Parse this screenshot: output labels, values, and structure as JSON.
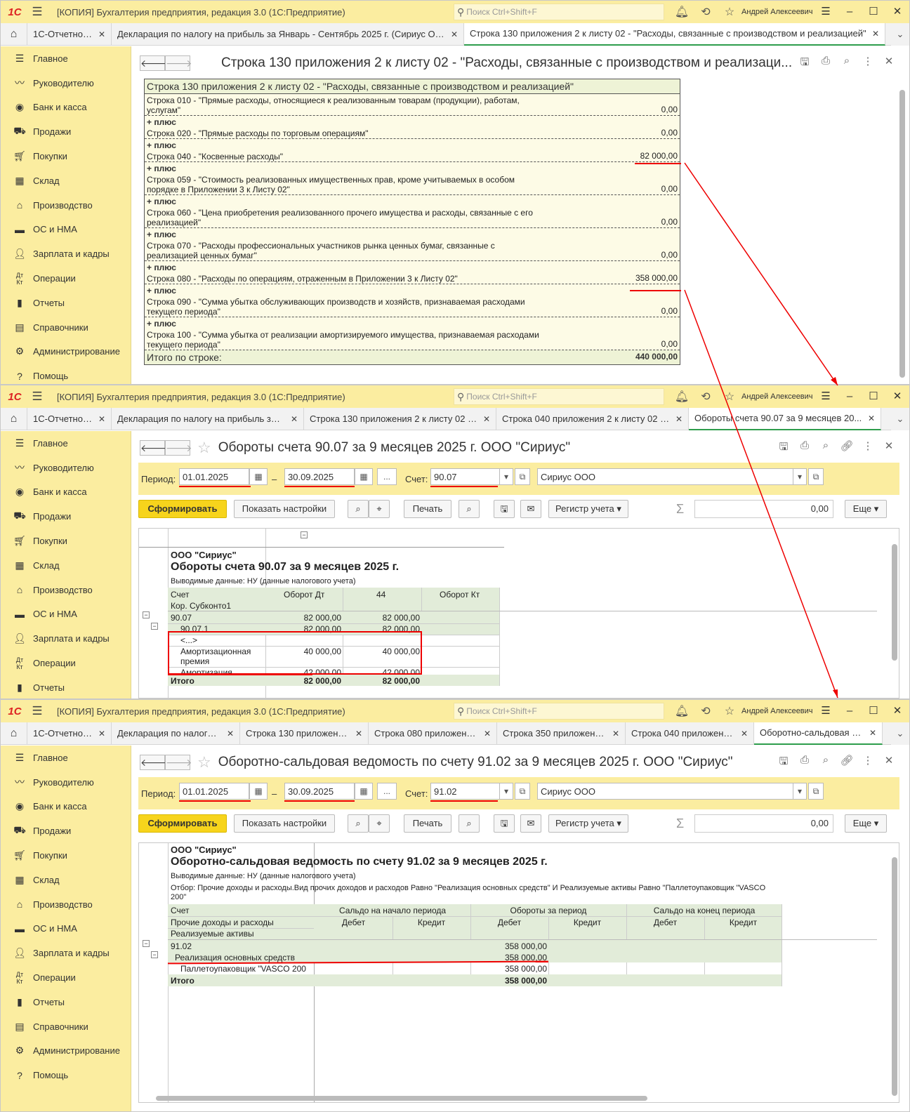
{
  "app": {
    "title": "[КОПИЯ] Бухгалтерия предприятия, редакция 3.0  (1С:Предприятие)",
    "search_placeholder": "Поиск Ctrl+Shift+F",
    "user": "Андрей Алексеевич",
    "logo": "1С"
  },
  "sidebar": [
    "Главное",
    "Руководителю",
    "Банк и касса",
    "Продажи",
    "Покупки",
    "Склад",
    "Производство",
    "ОС и НМА",
    "Зарплата и кадры",
    "Операции",
    "Отчеты",
    "Справочники",
    "Администрирование",
    "Помощь"
  ],
  "w1": {
    "tabs": [
      "1С-Отчетность",
      "Декларация по налогу на прибыль за Январь - Сентябрь 2025 г. (Сириус ООО)",
      "Строка 130 приложения 2 к листу 02 - \"Расходы, связанные с производством и реализацией\""
    ],
    "page_title": "Строка 130 приложения 2 к листу 02 - \"Расходы, связанные с производством и реализаци...",
    "table_title": "Строка 130 приложения 2 к листу 02 - \"Расходы, связанные с производством и реализацией\"",
    "plus": "+ плюс",
    "rows": [
      {
        "l1": "Строка 010 - \"Прямые расходы, относящиеся к реализованным товарам (продукции), работам,",
        "l2": "услугам\"",
        "v": "0,00"
      },
      {
        "l1": "Строка 020 - \"Прямые расходы по торговым операциям\"",
        "l2": "",
        "v": "0,00"
      },
      {
        "l1": "Строка 040 - \"Косвенные расходы\"",
        "l2": "",
        "v": "82 000,00"
      },
      {
        "l1": "Строка 059 - \"Стоимость реализованных имущественных прав, кроме учитываемых в особом",
        "l2": "порядке в Приложении 3 к Листу 02\"",
        "v": "0,00"
      },
      {
        "l1": "Строка 060 - \"Цена приобретения реализованного прочего имущества и расходы, связанные с его",
        "l2": "реализацией\"",
        "v": "0,00"
      },
      {
        "l1": "Строка 070 - \"Расходы профессиональных участников рынка ценных бумаг, связанные с",
        "l2": "реализацией ценных бумаг\"",
        "v": "0,00"
      },
      {
        "l1": "Строка 080 - \"Расходы по операциям, отраженным в Приложении 3 к Листу 02\"",
        "l2": "",
        "v": "358 000,00"
      },
      {
        "l1": "Строка 090 - \"Сумма убытка обслуживающих производств и хозяйств, признаваемая расходами",
        "l2": "текущего периода\"",
        "v": "0,00"
      },
      {
        "l1": "Строка 100 - \"Сумма убытка от реализации амортизируемого имущества, признаваемая расходами",
        "l2": "текущего периода\"",
        "v": "0,00"
      }
    ],
    "total_label": "Итого по строке:",
    "total_value": "440 000,00"
  },
  "w2": {
    "tabs": [
      "1С-Отчетность",
      "Декларация по налогу на прибыль за ...",
      "Строка 130 приложения 2 к листу 02 - ...",
      "Строка 040 приложения 2 к листу 02 -...",
      "Обороты счета 90.07 за 9 месяцев 20..."
    ],
    "page_title": "Обороты счета 90.07 за 9 месяцев 2025 г. ООО \"Сириус\"",
    "period_label": "Период:",
    "date_from": "01.01.2025",
    "date_to": "30.09.2025",
    "dash": "–",
    "dots": "...",
    "account_label": "Счет:",
    "account": "90.07",
    "org": "Сириус ООО",
    "btn_form": "Сформировать",
    "btn_settings": "Показать настройки",
    "btn_print": "Печать",
    "btn_register": "Регистр учета",
    "sum_value": "0,00",
    "btn_more": "Еще",
    "rep_org": "ООО \"Сириус\"",
    "rep_title": "Обороты счета 90.07 за 9 месяцев 2025 г.",
    "rep_sub": "Выводимые данные: НУ (данные налогового учета)",
    "col_account": "Счет",
    "col_kor": "Кор. Субконто1",
    "col_dt": "Оборот Дт",
    "col_44": "44",
    "col_kt": "Оборот Кт",
    "rows": [
      {
        "name": "90.07",
        "dt": "82 000,00",
        "c44": "82 000,00"
      },
      {
        "name": "90.07.1",
        "dt": "82 000,00",
        "c44": "82 000,00"
      },
      {
        "name": "<...>",
        "dt": "",
        "c44": ""
      },
      {
        "name": "Амортизационная",
        "name2": "премия",
        "dt": "40 000,00",
        "c44": "40 000,00"
      },
      {
        "name": "Амортизация",
        "dt": "42 000,00",
        "c44": "42 000,00"
      }
    ],
    "total_label": "Итого",
    "total_dt": "82 000,00",
    "total_44": "82 000,00"
  },
  "w3": {
    "tabs": [
      "1С-Отчетность",
      "Декларация по налогу ...",
      "Строка 130 приложени...",
      "Строка 080 приложени...",
      "Строка 350 приложени...",
      "Строка 040 приложени...",
      "Оборотно-сальдовая в..."
    ],
    "page_title": "Оборотно-сальдовая ведомость по счету 91.02 за 9 месяцев 2025 г. ООО \"Сириус\"",
    "account": "91.02",
    "rep_org": "ООО \"Сириус\"",
    "rep_title": "Оборотно-сальдовая ведомость по счету 91.02 за 9 месяцев 2025 г.",
    "rep_sub": "Выводимые данные: НУ (данные налогового учета)",
    "rep_filter1": "Отбор: Прочие доходы и расходы.Вид прочих доходов и расходов Равно \"Реализация основных средств\" И Реализуемые активы Равно \"Паллетоупаковщик \"VASCO",
    "rep_filter2": "200\"",
    "col_account": "Счет",
    "col_other": "Прочие доходы и расходы",
    "col_assets": "Реализуемые активы",
    "col_start": "Сальдо на начало периода",
    "col_turn": "Обороты за период",
    "col_end": "Сальдо на конец периода",
    "debit": "Дебет",
    "credit": "Кредит",
    "rows": [
      {
        "name": "91.02",
        "turn_dt": "358 000,00"
      },
      {
        "name": "Реализация основных средств",
        "turn_dt": "358 000,00"
      },
      {
        "name": "Паллетоупаковщик \"VASCO 200",
        "turn_dt": "358 000,00"
      }
    ],
    "total_label": "Итого",
    "total_turn_dt": "358 000,00"
  },
  "colors": {
    "yellow_panel": "#fbeda0",
    "green_band": "#e2ecd9",
    "annot_red": "#e00000",
    "active_tab": "#2e9d4c"
  }
}
